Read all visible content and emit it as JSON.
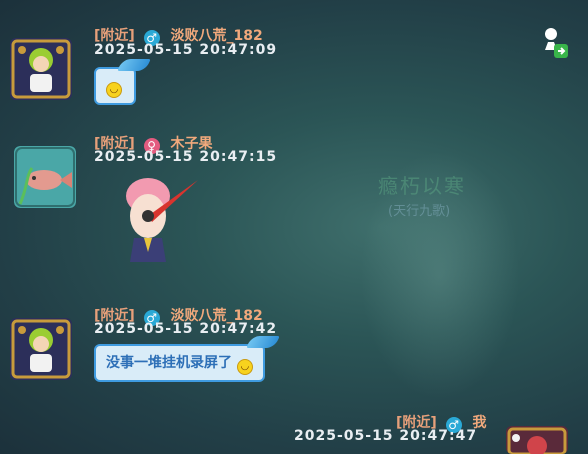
{
  "background": {
    "title": "瘾朽以寒",
    "subtitle": "(天行九歌)"
  },
  "messages": [
    {
      "channel": "[附近]",
      "gender_icon": "male",
      "name": "淡败八荒_182",
      "timestamp": "2025-05-15  20:47:09",
      "text": ""
    },
    {
      "channel": "[附近]",
      "gender_icon": "female",
      "name": "木子果",
      "timestamp": "2025-05-15  20:47:15",
      "text": ""
    },
    {
      "channel": "[附近]",
      "gender_icon": "male",
      "name": "淡败八荒_182",
      "timestamp": "2025-05-15  20:47:42",
      "text": "没事一堆挂机录屏了"
    },
    {
      "channel": "[附近]",
      "gender_icon": "male",
      "name": "我",
      "timestamp": "2025-05-15  20:47:47",
      "text": ""
    }
  ],
  "icons": {
    "male": "♂",
    "female": "♀",
    "smiley": "😆",
    "top_right": "speaker-export-icon"
  },
  "colors": {
    "channel": "#e7a07a",
    "name": "#f1a97c",
    "timestamp": "#e9eef2",
    "bubble_bg": "#d9ecf8",
    "bubble_border": "#3f9be0",
    "bubble_text": "#2d6fb7",
    "male": "#2aa9d6",
    "female": "#e35b7f"
  }
}
